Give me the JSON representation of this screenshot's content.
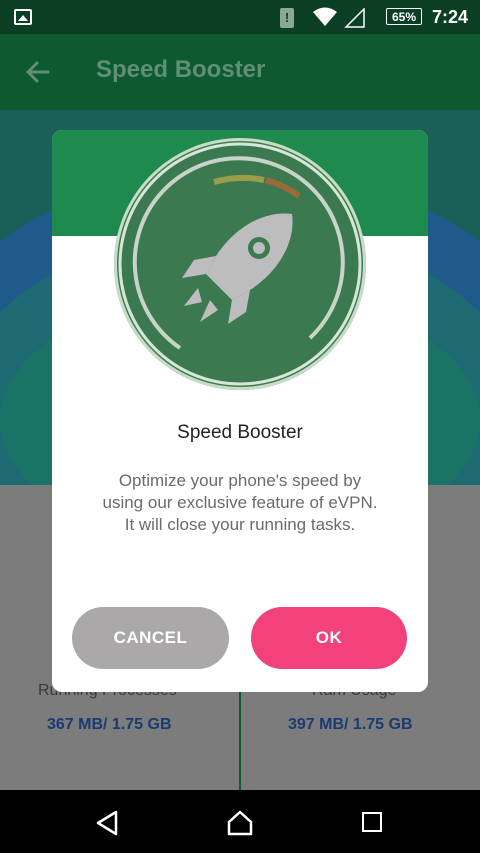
{
  "status_bar": {
    "battery": "65%",
    "time": "7:24",
    "icons": [
      "image-icon",
      "alert-icon",
      "wifi-icon",
      "signal-icon",
      "battery-icon"
    ]
  },
  "app_bar": {
    "title": "Speed Booster",
    "back_icon": "arrow-left-icon"
  },
  "background": {
    "left_label": "Running Processes",
    "left_value": "367 MB/ 1.75 GB",
    "right_label": "Ram Usage",
    "right_value": "397 MB/ 1.75 GB"
  },
  "dialog": {
    "icon": "rocket-icon",
    "title": "Speed Booster",
    "message": "Optimize your phone's speed by using our exclusive feature of eVPN. It will close your running tasks.",
    "cancel_label": "CANCEL",
    "ok_label": "OK"
  },
  "nav_bar": {
    "icons": [
      "nav-back-icon",
      "nav-home-icon",
      "nav-recent-icon"
    ]
  },
  "colors": {
    "primary_green": "#1e8a4e",
    "ok_pink": "#f2417b",
    "cancel_gray": "#aaa8a8"
  }
}
